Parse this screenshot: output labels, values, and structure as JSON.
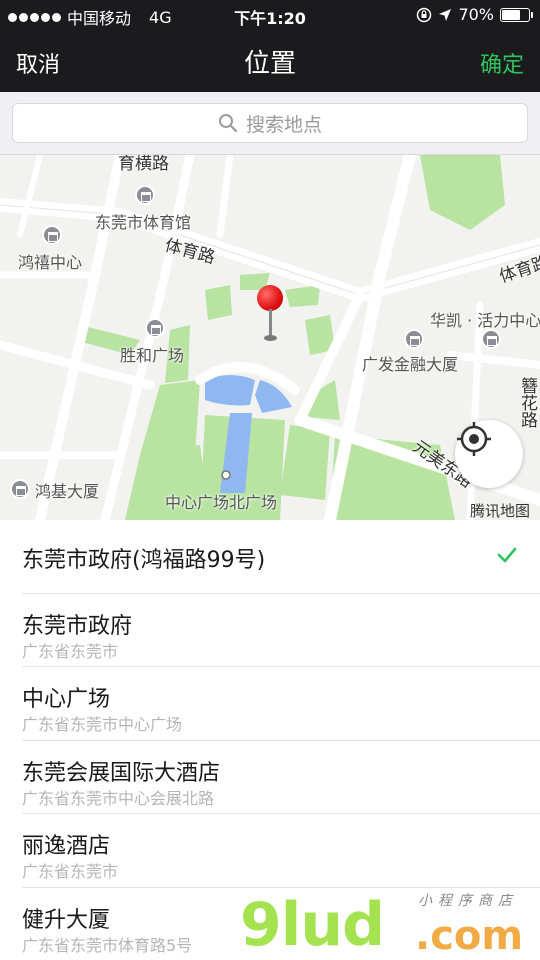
{
  "status_bar": {
    "carrier": "中国移动",
    "network": "4G",
    "time": "下午1:20",
    "battery_percent": "70%",
    "battery_level": 0.7
  },
  "nav": {
    "cancel": "取消",
    "title": "位置",
    "confirm": "确定",
    "confirm_color": "#2fc35a"
  },
  "search": {
    "placeholder": "搜索地点"
  },
  "map": {
    "labels": {
      "tiyu_guan": "东莞市体育馆",
      "hongxi": "鸿禧中心",
      "tiyu_road": "体育路",
      "tiyu_road_right": "体育路",
      "shenghe": "胜和广场",
      "huakai": "华凯 · 活力中心",
      "guangfa": "广发金融大厦",
      "yuanmei": "元美东路",
      "hongji": "鸿基大厦",
      "zhongxin_north": "中心广场北广场",
      "yuhang_top": "育横路",
      "right_vertical": "簪花路",
      "copyright": "腾讯地图"
    }
  },
  "results": [
    {
      "title": "东莞市政府(鸿福路99号)",
      "subtitle": "",
      "selected": true
    },
    {
      "title": "东莞市政府",
      "subtitle": "广东省东莞市",
      "selected": false
    },
    {
      "title": "中心广场",
      "subtitle": "广东省东莞市中心广场",
      "selected": false
    },
    {
      "title": "东莞会展国际大酒店",
      "subtitle": "广东省东莞市中心会展北路",
      "selected": false
    },
    {
      "title": "丽逸酒店",
      "subtitle": "广东省东莞市",
      "selected": false
    },
    {
      "title": "健升大厦",
      "subtitle": "广东省东莞市体育路5号",
      "selected": false
    }
  ],
  "watermark": {
    "main": "9lud",
    "dotcom": ".com",
    "tag": "小程序商店"
  }
}
